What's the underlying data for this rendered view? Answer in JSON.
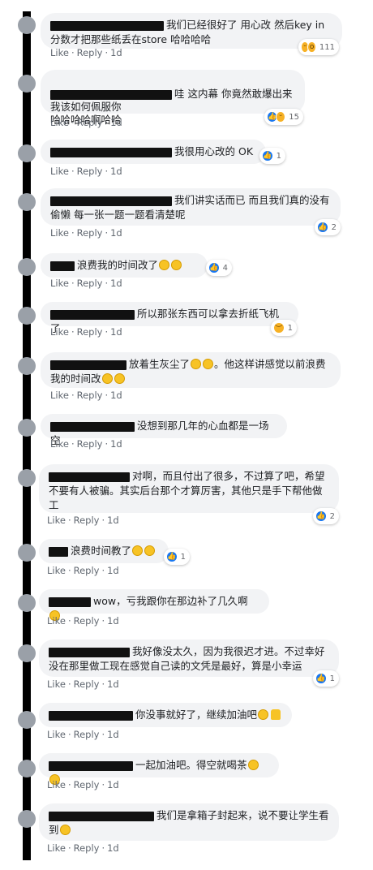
{
  "actions": {
    "like": "Like",
    "reply": "Reply",
    "sep": "·"
  },
  "comments": [
    {
      "text": "我们已经很好了 用心改 然后key in分数才把那些纸丢在store 哈哈哈哈",
      "time": "1d",
      "reaction_count": "111"
    },
    {
      "text": "哇 这内幕 你竟然敢爆出来\n我该如何佩服你\n哈哈哈哈啊哈哈",
      "time": "1d",
      "reaction_count": "15"
    },
    {
      "text": "我很用心改的 OK",
      "time": "1d",
      "reaction_count": "1"
    },
    {
      "text": "我们讲实话而已 而且我们真的没有偷懒 每一张一题一题看清楚呢",
      "time": "1d",
      "reaction_count": "2"
    },
    {
      "text": "浪费我的时间改了",
      "time": "1d",
      "reaction_count": "4"
    },
    {
      "text": "所以那张东西可以拿去折纸飞机了",
      "time": "1d",
      "reaction_count": "1"
    },
    {
      "text": "放着生灰尘了",
      "text2": "。他这样讲感觉以前浪费我的时间改",
      "time": "1d",
      "reaction_count": ""
    },
    {
      "text": "没想到那几年的心血都是一场空",
      "time": "1d",
      "reaction_count": ""
    },
    {
      "text": "对啊，而且付出了很多，不过算了吧，希望不要有人被骗。其实后台那个才算厉害，其他只是手下帮他做工",
      "time": "1d",
      "reaction_count": "2"
    },
    {
      "text": "浪费时间教了",
      "time": "1d",
      "reaction_count": "1"
    },
    {
      "text": "wow，亏我跟你在那边补了几久啊",
      "time": "1d",
      "reaction_count": ""
    },
    {
      "text": "我好像没太久，因为我很迟才进。不过幸好没在那里做工现在感觉自己读的文凭是最好，算是小幸运",
      "time": "1d",
      "reaction_count": "1"
    },
    {
      "text": "你没事就好了，继续加油吧",
      "time": "1d",
      "reaction_count": ""
    },
    {
      "text": "一起加油吧。得空就喝茶",
      "time": "1d",
      "reaction_count": ""
    },
    {
      "text": "我们是拿箱子封起来，说不要让学生看到",
      "time": "1d",
      "reaction_count": ""
    }
  ],
  "colors": {
    "bubble_bg": "#f2f3f5",
    "like_blue": "#1877f2",
    "emoji_yellow": "#f7c325",
    "redaction": "#111111"
  },
  "icons": {
    "like_reaction": "like-icon",
    "haha_reaction": "haha-emoji-icon",
    "sad_reaction": "sad-emoji-icon",
    "cool_emoji": "sunglasses-emoji-icon",
    "thumbs_up": "thumbs-up-icon"
  }
}
